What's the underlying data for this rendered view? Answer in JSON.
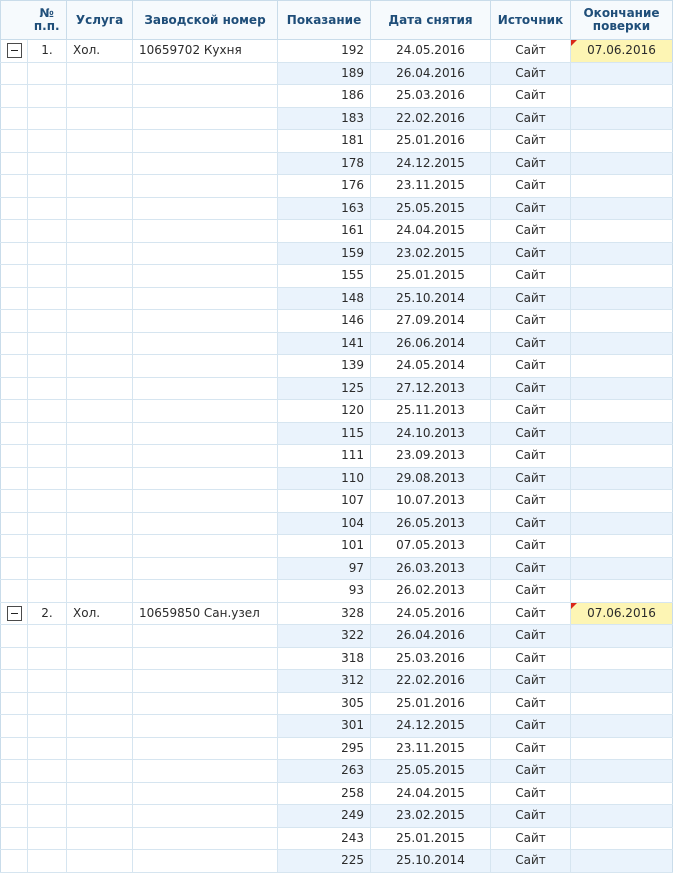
{
  "columns": {
    "num": "№ п.п.",
    "service": "Услуга",
    "serial": "Заводской номер",
    "reading": "Показание",
    "date": "Дата снятия",
    "source": "Источник",
    "verify_end": "Окончание поверки"
  },
  "groups": [
    {
      "num": "1.",
      "service": "Хол.",
      "serial": "10659702 Кухня",
      "verify_end": "07.06.2016",
      "readings": [
        {
          "reading": "192",
          "date": "24.05.2016",
          "source": "Сайт"
        },
        {
          "reading": "189",
          "date": "26.04.2016",
          "source": "Сайт"
        },
        {
          "reading": "186",
          "date": "25.03.2016",
          "source": "Сайт"
        },
        {
          "reading": "183",
          "date": "22.02.2016",
          "source": "Сайт"
        },
        {
          "reading": "181",
          "date": "25.01.2016",
          "source": "Сайт"
        },
        {
          "reading": "178",
          "date": "24.12.2015",
          "source": "Сайт"
        },
        {
          "reading": "176",
          "date": "23.11.2015",
          "source": "Сайт"
        },
        {
          "reading": "163",
          "date": "25.05.2015",
          "source": "Сайт"
        },
        {
          "reading": "161",
          "date": "24.04.2015",
          "source": "Сайт"
        },
        {
          "reading": "159",
          "date": "23.02.2015",
          "source": "Сайт"
        },
        {
          "reading": "155",
          "date": "25.01.2015",
          "source": "Сайт"
        },
        {
          "reading": "148",
          "date": "25.10.2014",
          "source": "Сайт"
        },
        {
          "reading": "146",
          "date": "27.09.2014",
          "source": "Сайт"
        },
        {
          "reading": "141",
          "date": "26.06.2014",
          "source": "Сайт"
        },
        {
          "reading": "139",
          "date": "24.05.2014",
          "source": "Сайт"
        },
        {
          "reading": "125",
          "date": "27.12.2013",
          "source": "Сайт"
        },
        {
          "reading": "120",
          "date": "25.11.2013",
          "source": "Сайт"
        },
        {
          "reading": "115",
          "date": "24.10.2013",
          "source": "Сайт"
        },
        {
          "reading": "111",
          "date": "23.09.2013",
          "source": "Сайт"
        },
        {
          "reading": "110",
          "date": "29.08.2013",
          "source": "Сайт"
        },
        {
          "reading": "107",
          "date": "10.07.2013",
          "source": "Сайт"
        },
        {
          "reading": "104",
          "date": "26.05.2013",
          "source": "Сайт"
        },
        {
          "reading": "101",
          "date": "07.05.2013",
          "source": "Сайт"
        },
        {
          "reading": "97",
          "date": "26.03.2013",
          "source": "Сайт"
        },
        {
          "reading": "93",
          "date": "26.02.2013",
          "source": "Сайт"
        }
      ]
    },
    {
      "num": "2.",
      "service": "Хол.",
      "serial": "10659850 Сан.узел",
      "verify_end": "07.06.2016",
      "readings": [
        {
          "reading": "328",
          "date": "24.05.2016",
          "source": "Сайт"
        },
        {
          "reading": "322",
          "date": "26.04.2016",
          "source": "Сайт"
        },
        {
          "reading": "318",
          "date": "25.03.2016",
          "source": "Сайт"
        },
        {
          "reading": "312",
          "date": "22.02.2016",
          "source": "Сайт"
        },
        {
          "reading": "305",
          "date": "25.01.2016",
          "source": "Сайт"
        },
        {
          "reading": "301",
          "date": "24.12.2015",
          "source": "Сайт"
        },
        {
          "reading": "295",
          "date": "23.11.2015",
          "source": "Сайт"
        },
        {
          "reading": "263",
          "date": "25.05.2015",
          "source": "Сайт"
        },
        {
          "reading": "258",
          "date": "24.04.2015",
          "source": "Сайт"
        },
        {
          "reading": "249",
          "date": "23.02.2015",
          "source": "Сайт"
        },
        {
          "reading": "243",
          "date": "25.01.2015",
          "source": "Сайт"
        },
        {
          "reading": "225",
          "date": "25.10.2014",
          "source": "Сайт"
        }
      ]
    }
  ]
}
